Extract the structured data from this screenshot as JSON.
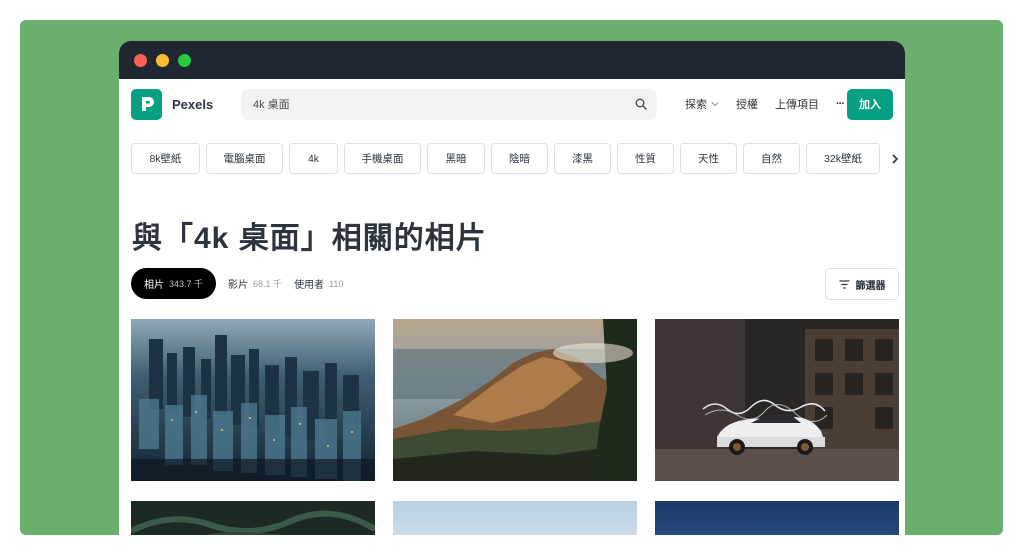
{
  "browser": {
    "dots": [
      "#ff5f57",
      "#febc2e",
      "#28c840"
    ]
  },
  "colors": {
    "accent": "#05a081",
    "frame": "#6aaf6e",
    "titlebar": "#1f2733"
  },
  "header": {
    "logo_letter": "P",
    "brand": "Pexels",
    "search_value": "4k 桌面",
    "nav": {
      "explore": "探索",
      "license": "授權",
      "upload": "上傳項目",
      "more": "···"
    },
    "join": "加入"
  },
  "tags": [
    "8k壁紙",
    "電腦桌面",
    "4k",
    "手機桌面",
    "黑暗",
    "陰暗",
    "漆黑",
    "性質",
    "天性",
    "自然",
    "32k壁紙"
  ],
  "page_title": "與「4k 桌面」相關的相片",
  "tabs": [
    {
      "label": "相片",
      "count": "343.7 千"
    },
    {
      "label": "影片",
      "count": "68.1 千"
    },
    {
      "label": "使用者",
      "count": "110"
    }
  ],
  "filter_label": "篩選器",
  "photos": [
    {
      "subject": "city-aerial"
    },
    {
      "subject": "mountain-ridge"
    },
    {
      "subject": "white-car-night"
    },
    {
      "subject": "palm-leaves"
    },
    {
      "subject": "sky"
    },
    {
      "subject": "night-sky"
    }
  ]
}
